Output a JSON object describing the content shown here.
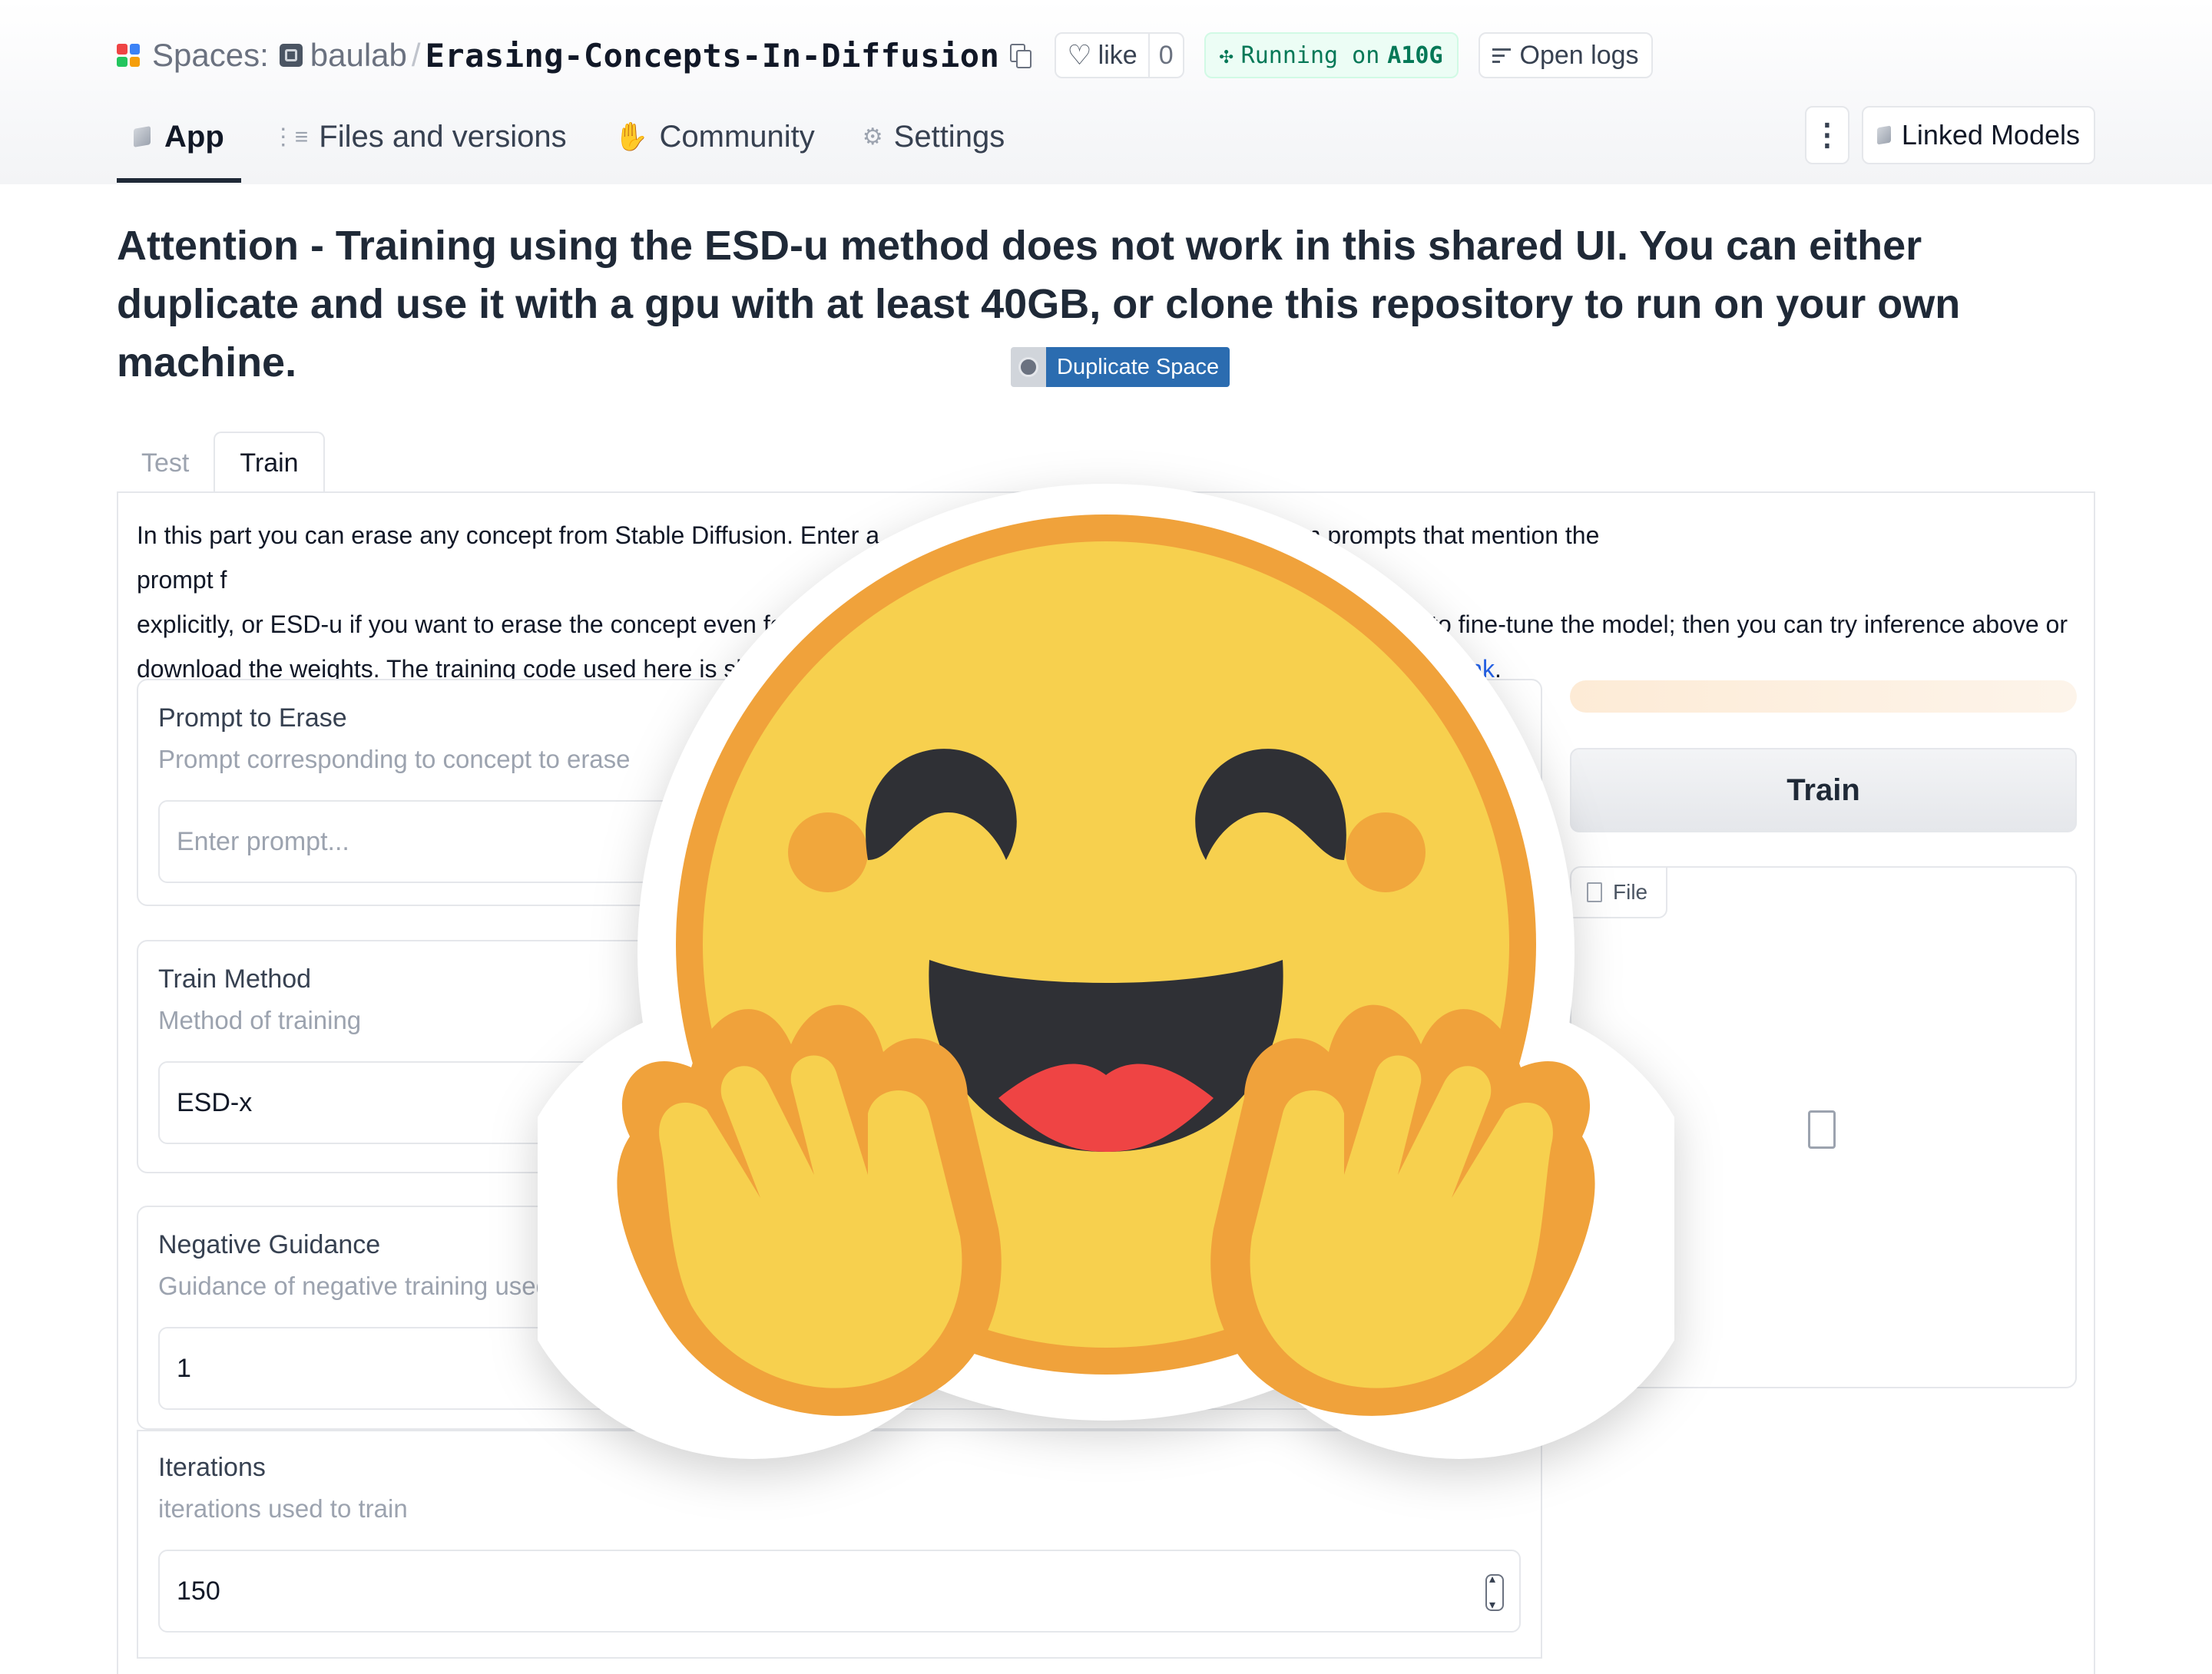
{
  "header": {
    "spaces_label": "Spaces:",
    "org": "baulab",
    "separator": "/",
    "repo": "Erasing-Concepts-In-Diffusion",
    "like_label": "like",
    "like_count": "0",
    "running_label": "Running on",
    "running_hw": "A10G",
    "logs_label": "Open logs",
    "more_label": "⋮",
    "linked_label": "Linked Models"
  },
  "nav_tabs": [
    {
      "label": "App",
      "icon": "cube-icon"
    },
    {
      "label": "Files and versions",
      "icon": "files-icon"
    },
    {
      "label": "Community",
      "icon": "hand-icon"
    },
    {
      "label": "Settings",
      "icon": "gear-icon"
    }
  ],
  "main": {
    "attention": "Attention - Training using the ESD-u method does not work in this shared UI. You can either duplicate and use it with a gpu with at least 40GB, or clone this repository to run on your own machine.",
    "duplicate_label": "Duplicate Space",
    "tabs": [
      "Test",
      "Train"
    ],
    "description": {
      "line1a": "In this part you can erase any concept from Stable Diffusion. Enter a prompt f",
      "line1b": "D-x if you want to focus erasure on prompts that mention the concept",
      "line2a": "explicitly, or ESD-u if you want to erase the concept even for prompts t",
      "line2b": "20 minutes to fine-tune the model; then you can try inference above or",
      "line3a": "download the weights. The training code used here is slightly diff",
      "line3b": "link",
      "line3c": "."
    }
  },
  "form": {
    "prompt": {
      "label": "Prompt to Erase",
      "info": "Prompt corresponding to concept to erase",
      "placeholder": "Enter prompt..."
    },
    "method": {
      "label": "Train Method",
      "info": "Method of training",
      "value": "ESD-x"
    },
    "neg": {
      "label": "Negative Guidance",
      "info": "Guidance of negative training used to train",
      "value": "1"
    },
    "iter": {
      "label": "Iterations",
      "info": "iterations used to train",
      "value": "150"
    }
  },
  "output": {
    "train_label": "Train",
    "file_label": "File"
  },
  "colors": {
    "accent_blue": "#2b6cb0",
    "running_green": "#047857",
    "hug_yellow": "#f7d04e",
    "hug_orange": "#f0a23b",
    "hug_dark": "#2f3035",
    "hug_tongue": "#ef4444"
  }
}
